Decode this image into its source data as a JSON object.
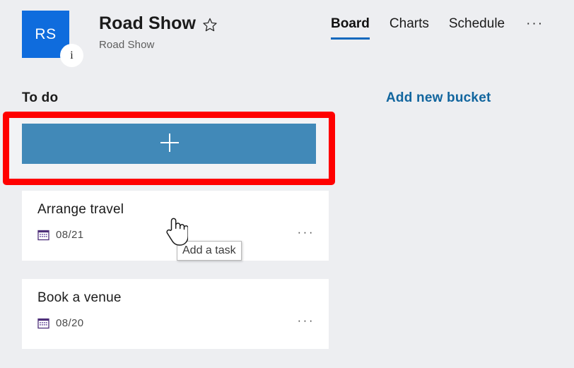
{
  "header": {
    "avatar_initials": "RS",
    "avatar_color": "#0f6cdd",
    "info_badge": "i",
    "plan_title": "Road Show",
    "group_name": "Road Show",
    "favorite_icon": "star-outline-icon"
  },
  "tabs": {
    "items": [
      {
        "label": "Board",
        "active": true
      },
      {
        "label": "Charts",
        "active": false
      },
      {
        "label": "Schedule",
        "active": false
      }
    ],
    "overflow_label": "···",
    "active_underline_color": "#1268bd"
  },
  "board": {
    "bucket_title": "To do",
    "add_bucket_label": "Add new bucket",
    "add_bucket_color": "#11659e",
    "add_task": {
      "bar_color": "#4189b8",
      "icon": "plus-icon",
      "tooltip": "Add a task"
    },
    "tasks": [
      {
        "title": "Arrange travel",
        "due_date": "08/21",
        "date_icon": "calendar-icon",
        "more_label": "···"
      },
      {
        "title": "Book a venue",
        "due_date": "08/20",
        "date_icon": "calendar-icon",
        "more_label": "···"
      }
    ]
  },
  "annotation": {
    "highlight_color": "#ff0000"
  }
}
